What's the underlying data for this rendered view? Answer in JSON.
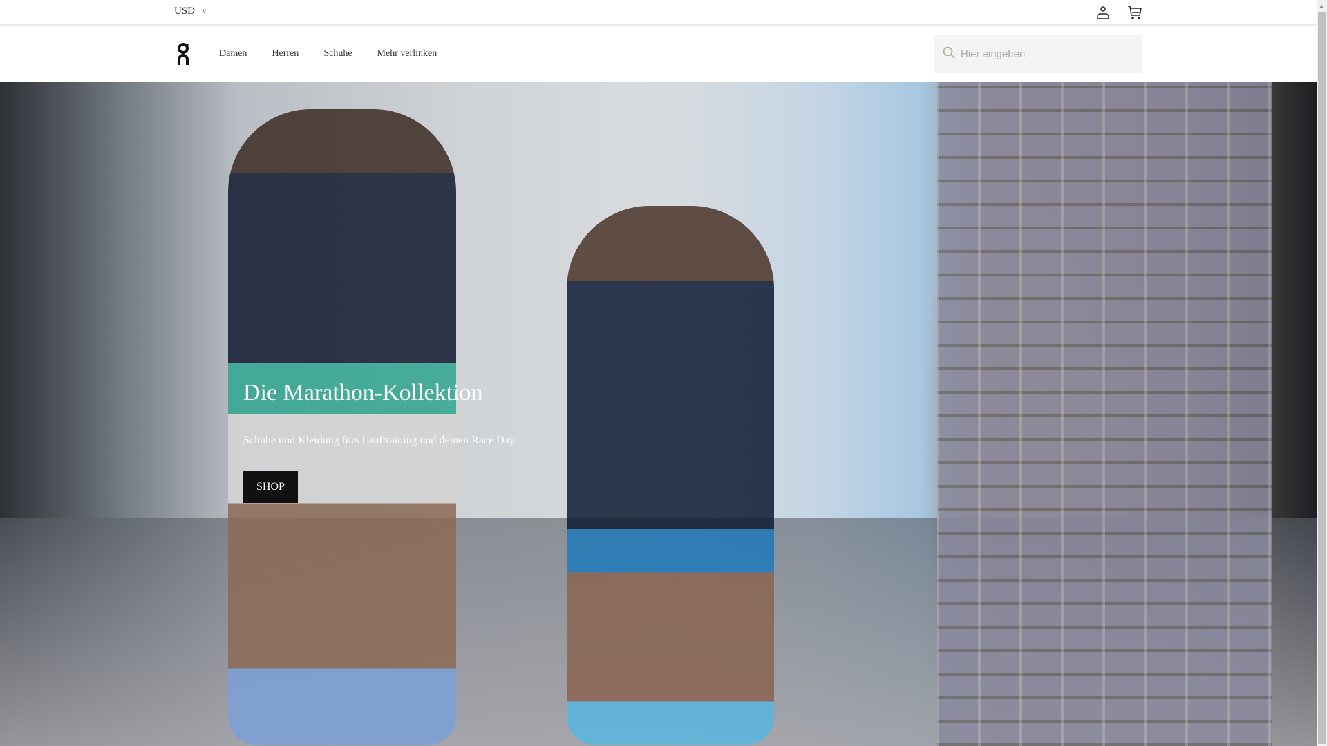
{
  "topbar": {
    "currency": "USD"
  },
  "header": {
    "nav": [
      "Damen",
      "Herren",
      "Schuhe",
      "Mehr verlinken"
    ],
    "search_placeholder": "Hier eingeben"
  },
  "hero": {
    "title": "Die Marathon-Kollektion",
    "subtitle": "Schuhe und Kleidung fürs Lauftraining und deinen Race Day.",
    "cta": "SHOP"
  }
}
